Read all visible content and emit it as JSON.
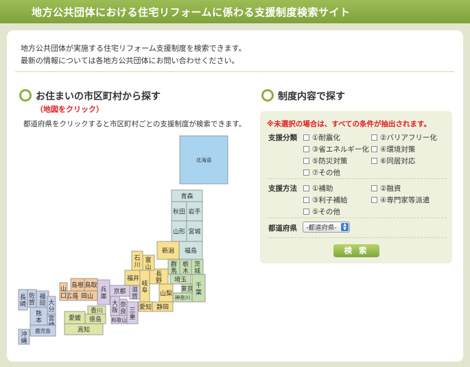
{
  "header": {
    "title": "地方公共団体における住宅リフォームに係わる支援制度検索サイト"
  },
  "intro": {
    "line1": "地方公共団体が実施する住宅リフォーム支援制度を検索できます。",
    "line2": "最新の情報については各地方公共団体にお問い合わせください。"
  },
  "map_section": {
    "title": "お住まいの市区町村から探す",
    "hint": "（地図をクリック）",
    "description": "都道府県をクリックすると市区町村ごとの支援制度が検索できます。",
    "prefectures": [
      "北海道",
      "青森",
      "秋田",
      "岩手",
      "山形",
      "宮城",
      "福島",
      "新潟",
      "茨城",
      "栃木",
      "群馬",
      "埼玉",
      "千葉",
      "東京",
      "神奈川",
      "山梨",
      "長野",
      "静岡",
      "富山",
      "石川",
      "福井",
      "岐阜",
      "愛知",
      "滋賀",
      "三重",
      "京都",
      "奈良",
      "大阪",
      "和歌山",
      "兵庫",
      "鳥取",
      "島根",
      "岡山",
      "広島",
      "山口",
      "香川",
      "徳島",
      "愛媛",
      "高知",
      "福岡",
      "佐賀",
      "長崎",
      "大分",
      "熊本",
      "宮崎",
      "鹿児島",
      "沖縄"
    ]
  },
  "search_section": {
    "title": "制度内容で探す",
    "notice": "※未選択の場合は、すべての条件が抽出されます。",
    "support_type": {
      "label": "支援分類",
      "options": [
        "①耐震化",
        "②バリアフリー化",
        "③省エネルギー化",
        "④環境対策",
        "⑤防災対策",
        "⑥同居対応",
        "⑦その他"
      ]
    },
    "support_method": {
      "label": "支援方法",
      "options": [
        "①補助",
        "②融資",
        "③利子補給",
        "④専門家等派遣",
        "⑤その他"
      ]
    },
    "prefecture": {
      "label": "都道府県",
      "selected": "-都道府県-"
    },
    "search_button": "検 索"
  },
  "colors": {
    "hokkaido": "#a8d4ef",
    "tohoku": "#cfe3e3",
    "kanto": "#c6e0b4",
    "chubu": "#f8e08e",
    "kinki": "#d9cde9",
    "chugoku": "#f4c9a0",
    "shikoku": "#dfe6a8",
    "kyushu": "#c6d2ec",
    "okinawa": "#c6d2ec",
    "accent": "#8fae3e",
    "alert": "#e02020"
  }
}
